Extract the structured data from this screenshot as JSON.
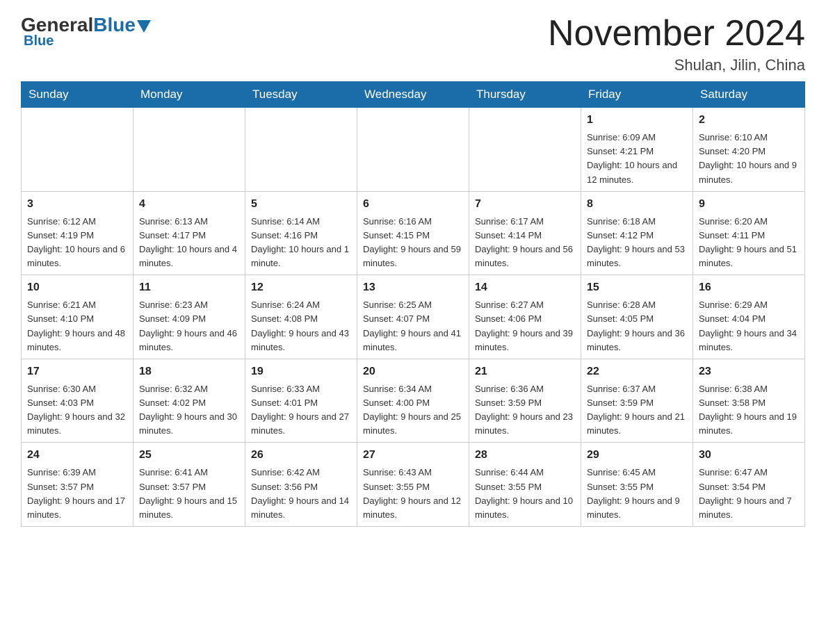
{
  "header": {
    "logo_general": "General",
    "logo_blue": "Blue",
    "month_title": "November 2024",
    "location": "Shulan, Jilin, China"
  },
  "weekdays": [
    "Sunday",
    "Monday",
    "Tuesday",
    "Wednesday",
    "Thursday",
    "Friday",
    "Saturday"
  ],
  "weeks": [
    [
      {
        "day": "",
        "info": ""
      },
      {
        "day": "",
        "info": ""
      },
      {
        "day": "",
        "info": ""
      },
      {
        "day": "",
        "info": ""
      },
      {
        "day": "",
        "info": ""
      },
      {
        "day": "1",
        "info": "Sunrise: 6:09 AM\nSunset: 4:21 PM\nDaylight: 10 hours and 12 minutes."
      },
      {
        "day": "2",
        "info": "Sunrise: 6:10 AM\nSunset: 4:20 PM\nDaylight: 10 hours and 9 minutes."
      }
    ],
    [
      {
        "day": "3",
        "info": "Sunrise: 6:12 AM\nSunset: 4:19 PM\nDaylight: 10 hours and 6 minutes."
      },
      {
        "day": "4",
        "info": "Sunrise: 6:13 AM\nSunset: 4:17 PM\nDaylight: 10 hours and 4 minutes."
      },
      {
        "day": "5",
        "info": "Sunrise: 6:14 AM\nSunset: 4:16 PM\nDaylight: 10 hours and 1 minute."
      },
      {
        "day": "6",
        "info": "Sunrise: 6:16 AM\nSunset: 4:15 PM\nDaylight: 9 hours and 59 minutes."
      },
      {
        "day": "7",
        "info": "Sunrise: 6:17 AM\nSunset: 4:14 PM\nDaylight: 9 hours and 56 minutes."
      },
      {
        "day": "8",
        "info": "Sunrise: 6:18 AM\nSunset: 4:12 PM\nDaylight: 9 hours and 53 minutes."
      },
      {
        "day": "9",
        "info": "Sunrise: 6:20 AM\nSunset: 4:11 PM\nDaylight: 9 hours and 51 minutes."
      }
    ],
    [
      {
        "day": "10",
        "info": "Sunrise: 6:21 AM\nSunset: 4:10 PM\nDaylight: 9 hours and 48 minutes."
      },
      {
        "day": "11",
        "info": "Sunrise: 6:23 AM\nSunset: 4:09 PM\nDaylight: 9 hours and 46 minutes."
      },
      {
        "day": "12",
        "info": "Sunrise: 6:24 AM\nSunset: 4:08 PM\nDaylight: 9 hours and 43 minutes."
      },
      {
        "day": "13",
        "info": "Sunrise: 6:25 AM\nSunset: 4:07 PM\nDaylight: 9 hours and 41 minutes."
      },
      {
        "day": "14",
        "info": "Sunrise: 6:27 AM\nSunset: 4:06 PM\nDaylight: 9 hours and 39 minutes."
      },
      {
        "day": "15",
        "info": "Sunrise: 6:28 AM\nSunset: 4:05 PM\nDaylight: 9 hours and 36 minutes."
      },
      {
        "day": "16",
        "info": "Sunrise: 6:29 AM\nSunset: 4:04 PM\nDaylight: 9 hours and 34 minutes."
      }
    ],
    [
      {
        "day": "17",
        "info": "Sunrise: 6:30 AM\nSunset: 4:03 PM\nDaylight: 9 hours and 32 minutes."
      },
      {
        "day": "18",
        "info": "Sunrise: 6:32 AM\nSunset: 4:02 PM\nDaylight: 9 hours and 30 minutes."
      },
      {
        "day": "19",
        "info": "Sunrise: 6:33 AM\nSunset: 4:01 PM\nDaylight: 9 hours and 27 minutes."
      },
      {
        "day": "20",
        "info": "Sunrise: 6:34 AM\nSunset: 4:00 PM\nDaylight: 9 hours and 25 minutes."
      },
      {
        "day": "21",
        "info": "Sunrise: 6:36 AM\nSunset: 3:59 PM\nDaylight: 9 hours and 23 minutes."
      },
      {
        "day": "22",
        "info": "Sunrise: 6:37 AM\nSunset: 3:59 PM\nDaylight: 9 hours and 21 minutes."
      },
      {
        "day": "23",
        "info": "Sunrise: 6:38 AM\nSunset: 3:58 PM\nDaylight: 9 hours and 19 minutes."
      }
    ],
    [
      {
        "day": "24",
        "info": "Sunrise: 6:39 AM\nSunset: 3:57 PM\nDaylight: 9 hours and 17 minutes."
      },
      {
        "day": "25",
        "info": "Sunrise: 6:41 AM\nSunset: 3:57 PM\nDaylight: 9 hours and 15 minutes."
      },
      {
        "day": "26",
        "info": "Sunrise: 6:42 AM\nSunset: 3:56 PM\nDaylight: 9 hours and 14 minutes."
      },
      {
        "day": "27",
        "info": "Sunrise: 6:43 AM\nSunset: 3:55 PM\nDaylight: 9 hours and 12 minutes."
      },
      {
        "day": "28",
        "info": "Sunrise: 6:44 AM\nSunset: 3:55 PM\nDaylight: 9 hours and 10 minutes."
      },
      {
        "day": "29",
        "info": "Sunrise: 6:45 AM\nSunset: 3:55 PM\nDaylight: 9 hours and 9 minutes."
      },
      {
        "day": "30",
        "info": "Sunrise: 6:47 AM\nSunset: 3:54 PM\nDaylight: 9 hours and 7 minutes."
      }
    ]
  ]
}
